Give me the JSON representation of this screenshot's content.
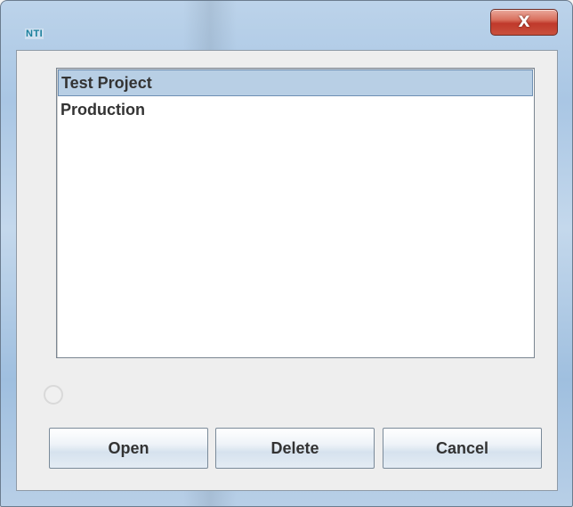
{
  "window": {
    "logo_text": "NTI",
    "close_glyph": "X"
  },
  "list": {
    "items": [
      {
        "label": "Test Project",
        "selected": true
      },
      {
        "label": "Production",
        "selected": false
      }
    ]
  },
  "buttons": {
    "open_label": "Open",
    "delete_label": "Delete",
    "cancel_label": "Cancel"
  },
  "icons": {
    "close": "close-icon",
    "status": "radio-indicator-icon"
  },
  "colors": {
    "selection": "#b8cfe5",
    "close_button": "#c0392b",
    "logo": "#1a7f9c"
  }
}
